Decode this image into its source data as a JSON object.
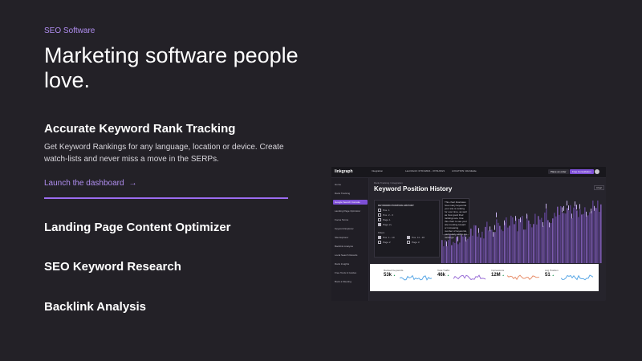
{
  "eyebrow": "SEO Software",
  "headline": "Marketing software people love.",
  "features": [
    {
      "title": "Accurate Keyword Rank Tracking",
      "description": "Get Keyword Rankings for any language, location or device. Create watch-lists and never miss a move in the SERPs.",
      "link_label": "Launch the dashboard",
      "link_arrow": "→"
    },
    {
      "title": "Landing Page Content Optimizer"
    },
    {
      "title": "SEO Keyword Research"
    },
    {
      "title": "Backlink Analysis"
    }
  ],
  "mockup": {
    "logo": "linkgraph",
    "topbar": {
      "project": "Integration",
      "date_range": "Last Month: 07/01/2021 - 07/31/2021",
      "location": "LOCATION: Worldwide",
      "place_order": "Place an order",
      "free_consultation": "Free Consultation"
    },
    "sidebar": {
      "items": [
        "Home",
        "Rank Tracking",
        "Google Search Console",
        "Landing Page Optimizer",
        "Focus Terms",
        "Keyword Explorer",
        "Site Explorer",
        "Backlink Analysis",
        "Local Search Results",
        "Rank Insights",
        "Free Tools & Guides",
        "Book a Meeting"
      ],
      "active_index": 2
    },
    "breadcrumb": "Rank Tracking / Integration",
    "title": "Keyword Position History",
    "options_label": "Chart",
    "legend": {
      "title": "KEYWORD POSITION HISTORY",
      "group1": [
        "Pos. 1",
        "Pos. 2 - 3",
        "Page 1",
        "Page 2+"
      ],
      "group2_title": "Filters",
      "group2": [
        "Pos. 1 - 10",
        "Pos. 11 - 20",
        "Page 2",
        "Page 3"
      ]
    },
    "tooltip": "This chart illustrates how many keywords your site is ranking for over time, as well as how good their rankings are. Use this chart to see your site trending toward or increasing number of keywords, particularly within top rankings.",
    "cards": [
      {
        "label": "Ranked Keywords",
        "value": "53k",
        "change": "▲"
      },
      {
        "label": "Total Traffic",
        "value": "46k",
        "change": "▲"
      },
      {
        "label": "Impressions",
        "value": "12M",
        "change": "▲"
      },
      {
        "label": "Avg Position",
        "value": "51",
        "change": "▲"
      }
    ],
    "colors": {
      "accent": "#9b6cf0",
      "chart_fill": "#6e4aa8",
      "card_blue": "#5aa8e6",
      "card_purple": "#9a6fd6",
      "card_orange": "#e88f6b"
    }
  }
}
